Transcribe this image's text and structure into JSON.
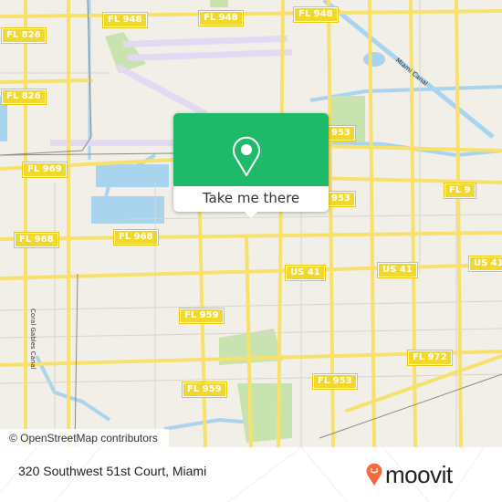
{
  "map": {
    "road_labels": [
      {
        "id": "fl948-a",
        "text": "FL 948"
      },
      {
        "id": "fl948-b",
        "text": "FL 948"
      },
      {
        "id": "fl948-c",
        "text": "FL 948"
      },
      {
        "id": "fl826-a",
        "text": "FL 826"
      },
      {
        "id": "fl826-b",
        "text": "FL 826"
      },
      {
        "id": "fl969",
        "text": "FL 969"
      },
      {
        "id": "fl968-a",
        "text": "FL 968"
      },
      {
        "id": "fl968-b",
        "text": "FL 968"
      },
      {
        "id": "fl953-a",
        "text": "953"
      },
      {
        "id": "fl953-b",
        "text": "953"
      },
      {
        "id": "fl9",
        "text": "FL 9"
      },
      {
        "id": "us41-a",
        "text": "US 41"
      },
      {
        "id": "us41-b",
        "text": "US 41"
      },
      {
        "id": "us41-c",
        "text": "US 41"
      },
      {
        "id": "fl959-a",
        "text": "FL 959"
      },
      {
        "id": "fl959-b",
        "text": "FL 959"
      },
      {
        "id": "fl972",
        "text": "FL 972"
      },
      {
        "id": "fl953-c",
        "text": "FL 953"
      }
    ],
    "water_labels": {
      "miami_canal": "Miami Canal",
      "coral_gables_canal": "Coral Gables Canal"
    },
    "attribution": "© OpenStreetMap contributors",
    "colors": {
      "land": "#f2efe9",
      "major_road": "#f7e16b",
      "water": "#a8d4ee",
      "park": "#c8e3b0",
      "runway": "#e3d9f2"
    }
  },
  "popup": {
    "icon": "map-pin-icon",
    "button_label": "Take me there",
    "color": "#1fba69"
  },
  "footer": {
    "address": "320 Southwest 51st Court, Miami",
    "brand": "moovit",
    "brand_color": "#f26a3d"
  }
}
